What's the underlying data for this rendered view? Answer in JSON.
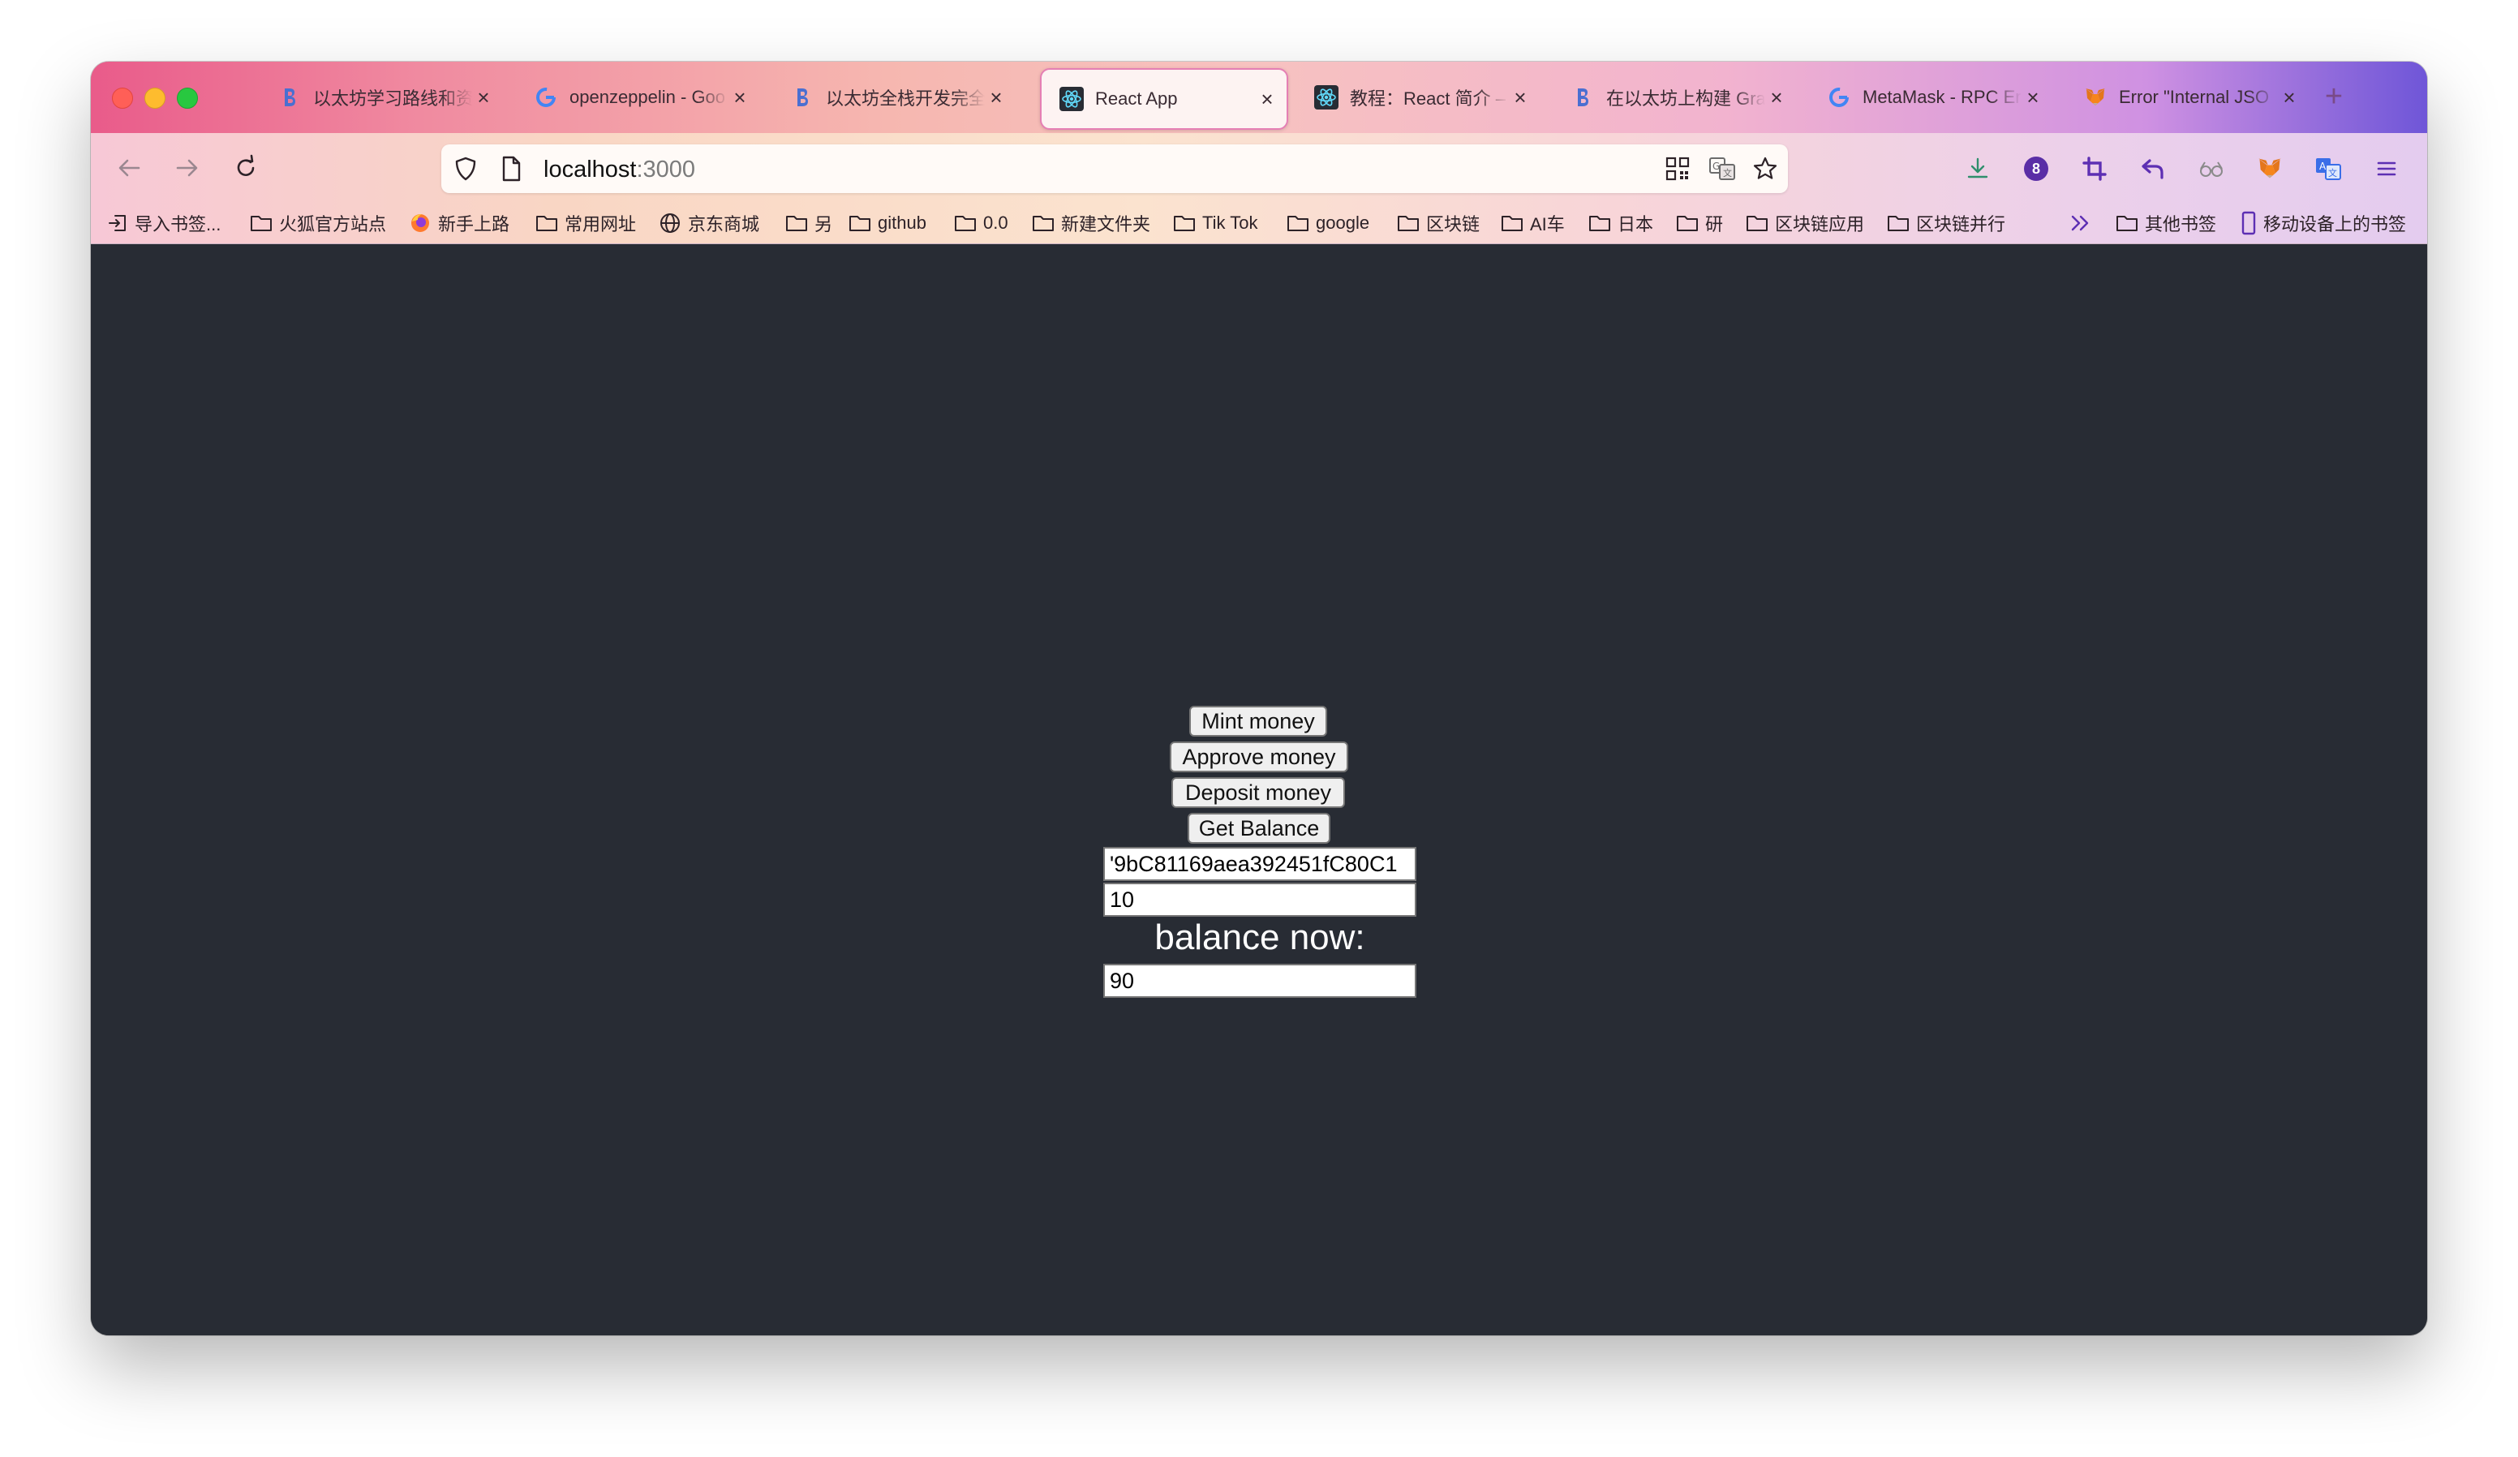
{
  "tabs": [
    {
      "title": "以太坊学习路线和资",
      "icon": "blockchain-logo-icon",
      "active": false
    },
    {
      "title": "openzeppelin - Goo",
      "icon": "google-g-icon",
      "active": false
    },
    {
      "title": "以太坊全栈开发完全",
      "icon": "blockchain-logo-icon",
      "active": false
    },
    {
      "title": "React App",
      "icon": "react-logo-icon",
      "active": true
    },
    {
      "title": "教程：React 简介 –",
      "icon": "react-logo-icon",
      "active": false
    },
    {
      "title": "在以太坊上构建 Gra",
      "icon": "blockchain-logo-icon",
      "active": false
    },
    {
      "title": "MetaMask - RPC Er",
      "icon": "google-g-icon",
      "active": false
    },
    {
      "title": "Error \"Internal JSO",
      "icon": "metamask-fox-icon",
      "active": false
    }
  ],
  "urlbar": {
    "host": "localhost",
    "port": ":3000"
  },
  "extension_badge": "8",
  "bookmarks": [
    {
      "label": "导入书签...",
      "icon": "import-icon"
    },
    {
      "label": "火狐官方站点",
      "icon": "folder-icon"
    },
    {
      "label": "新手上路",
      "icon": "firefox-icon"
    },
    {
      "label": "常用网址",
      "icon": "folder-icon"
    },
    {
      "label": "京东商城",
      "icon": "globe-icon"
    },
    {
      "label": "另",
      "icon": "folder-icon"
    },
    {
      "label": "github",
      "icon": "folder-icon"
    },
    {
      "label": "0.0",
      "icon": "folder-icon"
    },
    {
      "label": "新建文件夹",
      "icon": "folder-icon"
    },
    {
      "label": "Tik Tok",
      "icon": "folder-icon"
    },
    {
      "label": "google",
      "icon": "folder-icon"
    },
    {
      "label": "区块链",
      "icon": "folder-icon"
    },
    {
      "label": "AI车",
      "icon": "folder-icon"
    },
    {
      "label": "日本",
      "icon": "folder-icon"
    },
    {
      "label": "研",
      "icon": "folder-icon"
    },
    {
      "label": "区块链应用",
      "icon": "folder-icon"
    },
    {
      "label": "区块链并行",
      "icon": "folder-icon"
    }
  ],
  "bookmarks_right": [
    {
      "label": "其他书签",
      "icon": "folder-icon"
    },
    {
      "label": "移动设备上的书签",
      "icon": "mobile-icon"
    }
  ],
  "app": {
    "mint_label": "Mint money",
    "approve_label": "Approve money",
    "deposit_label": "Deposit money",
    "get_balance_label": "Get Balance",
    "address_value": "'9bC81169aea392451fC80C1",
    "amount_value": "10",
    "balance_label": "balance now:",
    "balance_value": "90"
  },
  "colors": {
    "content_bg": "#282c34",
    "accent": "#e57fb4"
  }
}
